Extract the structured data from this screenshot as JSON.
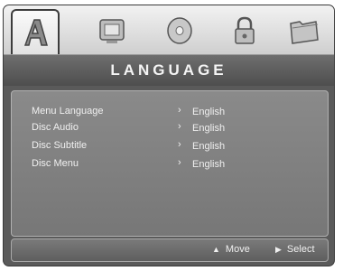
{
  "tabs": [
    {
      "icon": "language-icon",
      "active": true
    },
    {
      "icon": "display-icon",
      "active": false
    },
    {
      "icon": "disc-icon",
      "active": false
    },
    {
      "icon": "lock-icon",
      "active": false
    },
    {
      "icon": "folder-icon",
      "active": false
    }
  ],
  "title": "LANGUAGE",
  "settings": [
    {
      "label": "Menu Language",
      "value": "English"
    },
    {
      "label": "Disc Audio",
      "value": "English"
    },
    {
      "label": "Disc Subtitle",
      "value": "English"
    },
    {
      "label": "Disc Menu",
      "value": "English"
    }
  ],
  "footer": {
    "move_label": "Move",
    "select_label": "Select"
  },
  "colors": {
    "frame": "#5a5a5a",
    "icon_bar": "#dcdcdc",
    "text": "#f0f0f0"
  }
}
